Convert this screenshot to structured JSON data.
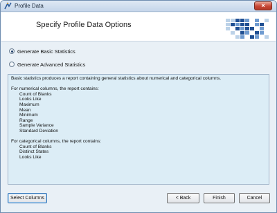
{
  "window": {
    "title": "Profile Data",
    "close_glyph": "×",
    "icon": "profile-data-app-icon"
  },
  "header": {
    "title": "Specify Profile Data Options",
    "graphic": "data-grid-graphic"
  },
  "options": [
    {
      "label": "Generate Basic Statistics",
      "checked": true
    },
    {
      "label": "Generate Advanced Statistics",
      "checked": false
    }
  ],
  "description": {
    "intro": "Basic statistics produces a report containing general statistics about numerical and categorical columns.",
    "numerical_heading": "For numerical columns, the report contains:",
    "numerical_items": [
      "Count of Blanks",
      "Looks Like",
      "Maximum",
      "Mean",
      "Minimum",
      "Range",
      "Sample Variance",
      "Standard Deviation"
    ],
    "categorical_heading": "For categorical columns, the report contains:",
    "categorical_items": [
      "Count of Blanks",
      "Distinct States",
      "Looks Like"
    ]
  },
  "buttons": {
    "select_columns": "Select Columns",
    "back": "< Back",
    "finish": "Finish",
    "cancel": "Cancel"
  },
  "colors": {
    "title_bar": "#c5d6ea",
    "description_bg": "#dcedf6",
    "close_button": "#c74634"
  }
}
